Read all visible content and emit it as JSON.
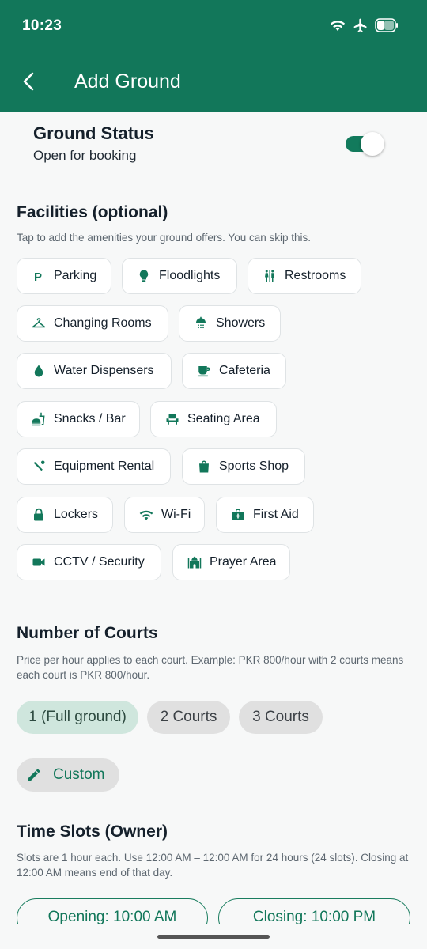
{
  "status_bar": {
    "time": "10:23"
  },
  "app_bar": {
    "title": "Add Ground"
  },
  "ground_status": {
    "title": "Ground Status",
    "subtitle": "Open for booking",
    "enabled": true
  },
  "facilities": {
    "title": "Facilities (optional)",
    "description": "Tap to add the amenities your ground offers. You can skip this.",
    "items": [
      {
        "label": "Parking",
        "icon": "parking-icon"
      },
      {
        "label": "Floodlights",
        "icon": "lightbulb-icon"
      },
      {
        "label": "Restrooms",
        "icon": "restroom-icon"
      },
      {
        "label": "Changing Rooms",
        "icon": "hanger-icon"
      },
      {
        "label": "Showers",
        "icon": "shower-icon"
      },
      {
        "label": "Water Dispensers",
        "icon": "water-drop-icon"
      },
      {
        "label": "Cafeteria",
        "icon": "coffee-icon"
      },
      {
        "label": "Snacks / Bar",
        "icon": "fastfood-icon"
      },
      {
        "label": "Seating Area",
        "icon": "seat-icon"
      },
      {
        "label": "Equipment Rental",
        "icon": "sports-equipment-icon"
      },
      {
        "label": "Sports Shop",
        "icon": "shopping-bag-icon"
      },
      {
        "label": "Lockers",
        "icon": "lock-icon"
      },
      {
        "label": "Wi-Fi",
        "icon": "wifi-icon"
      },
      {
        "label": "First Aid",
        "icon": "medical-bag-icon"
      },
      {
        "label": "CCTV / Security",
        "icon": "videocam-icon"
      },
      {
        "label": "Prayer Area",
        "icon": "mosque-icon"
      }
    ]
  },
  "courts": {
    "title": "Number of Courts",
    "description": "Price per hour applies to each court. Example: PKR 800/hour with 2 courts means each court is PKR 800/hour.",
    "options": [
      "1 (Full ground)",
      "2 Courts",
      "3 Courts"
    ],
    "selected": "1 (Full ground)",
    "custom_label": "Custom"
  },
  "time_slots": {
    "title": "Time Slots (Owner)",
    "description": "Slots are 1 hour each. Use 12:00 AM – 12:00 AM for 24 hours (24 slots). Closing at 12:00 AM means end of that day.",
    "opening": "Opening: 10:00 AM",
    "closing": "Closing: 10:00 PM"
  },
  "colors": {
    "primary": "#12775a",
    "icon": "#12775a",
    "selected_pill": "#cfe6dd",
    "pill": "#e0e0e0"
  }
}
